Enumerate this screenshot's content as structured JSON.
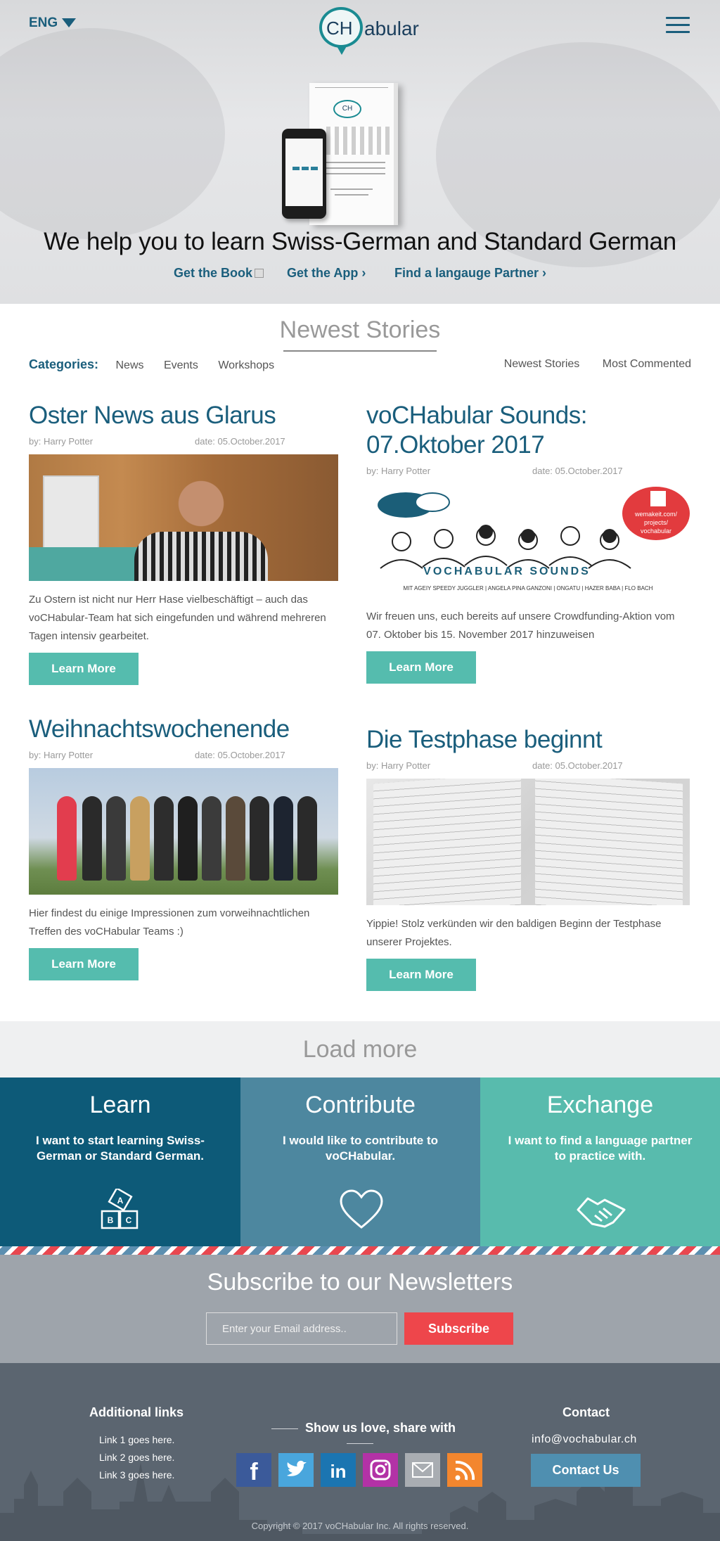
{
  "header": {
    "language": "ENG",
    "logo_ch": "CH",
    "logo_rest": "abular"
  },
  "hero": {
    "tagline": "We help you to learn Swiss-German and Standard German",
    "links": [
      "Get the Book",
      "Get the App ›",
      "Find a langauge Partner ›"
    ]
  },
  "stories": {
    "title": "Newest Stories",
    "categories_label": "Categories:",
    "categories": [
      "News",
      "Events",
      "Workshops"
    ],
    "sorts": [
      "Newest Stories",
      "Most Commented"
    ],
    "posts": [
      {
        "title": "Oster News aus Glarus",
        "author": "by: Harry Potter",
        "date": "date: 05.October.2017",
        "excerpt": "Zu Ostern ist nicht nur Herr Hase vielbeschäftigt – auch das voCHabular-Team hat sich eingefunden und während mehreren Tagen intensiv gearbeitet.",
        "button": "Learn More"
      },
      {
        "title": "voCHabular Sounds: 07.Oktober 2017",
        "author": "by: Harry Potter",
        "date": "date: 05.October.2017",
        "excerpt": "Wir freuen uns, euch bereits auf unsere Crowdfunding-Aktion vom 07. Oktober bis 15. November 2017 hinzuweisen",
        "button": "Learn More",
        "image_title": "VOCHABULAR SOUNDS",
        "image_caption": "MIT AGEIY SPEEDY JUGGLER | ANGELA PINA GANZONI | ONGATU | HAZER BABA | FLO BACH",
        "image_badge": "wemakeit.com/ projects/ vochabular"
      },
      {
        "title": "Weihnachtswochenende",
        "author": "by: Harry Potter",
        "date": "date: 05.October.2017",
        "excerpt": "Hier findest du einige Impressionen zum vorweihnachtlichen Treffen des voCHabular Teams :)",
        "button": "Learn More"
      },
      {
        "title": "Die Testphase beginnt",
        "author": "by: Harry Potter",
        "date": "date: 05.October.2017",
        "excerpt": "Yippie! Stolz verkünden wir den baldigen Beginn der Testphase unserer Projektes.",
        "button": "Learn More"
      }
    ],
    "load_more": "Load more"
  },
  "tiles": [
    {
      "title": "Learn",
      "text": "I want to start learning Swiss-German or Standard German.",
      "color": "#0d5a78",
      "icon": "abc-blocks-icon"
    },
    {
      "title": "Contribute",
      "text": "I would like to contribute to voCHabular.",
      "color": "#4d879f",
      "icon": "heart-icon"
    },
    {
      "title": "Exchange",
      "text": "I want to find a language partner to practice with.",
      "color": "#58bbad",
      "icon": "handshake-icon"
    }
  ],
  "newsletter": {
    "title": "Subscribe to our Newsletters",
    "placeholder": "Enter your Email address..",
    "button": "Subscribe"
  },
  "footer": {
    "links_title": "Additional links",
    "links": [
      "Link 1 goes here.",
      "Link 2 goes here.",
      "Link 3 goes here."
    ],
    "share_title": "Show us love, share with",
    "social": [
      {
        "name": "facebook-icon",
        "color": "#3b5a9a"
      },
      {
        "name": "twitter-icon",
        "color": "#49a6dd"
      },
      {
        "name": "linkedin-icon",
        "color": "#1b75b1"
      },
      {
        "name": "instagram-icon",
        "color": "#b332a6"
      },
      {
        "name": "mail-icon",
        "color": "#a9adb2"
      },
      {
        "name": "rss-icon",
        "color": "#f3862e"
      }
    ],
    "contact_title": "Contact",
    "email": "info@vochabular.ch",
    "contact_button": "Contact Us",
    "copyright": "Copyright © 2017 voCHabular Inc. All rights reserved."
  }
}
